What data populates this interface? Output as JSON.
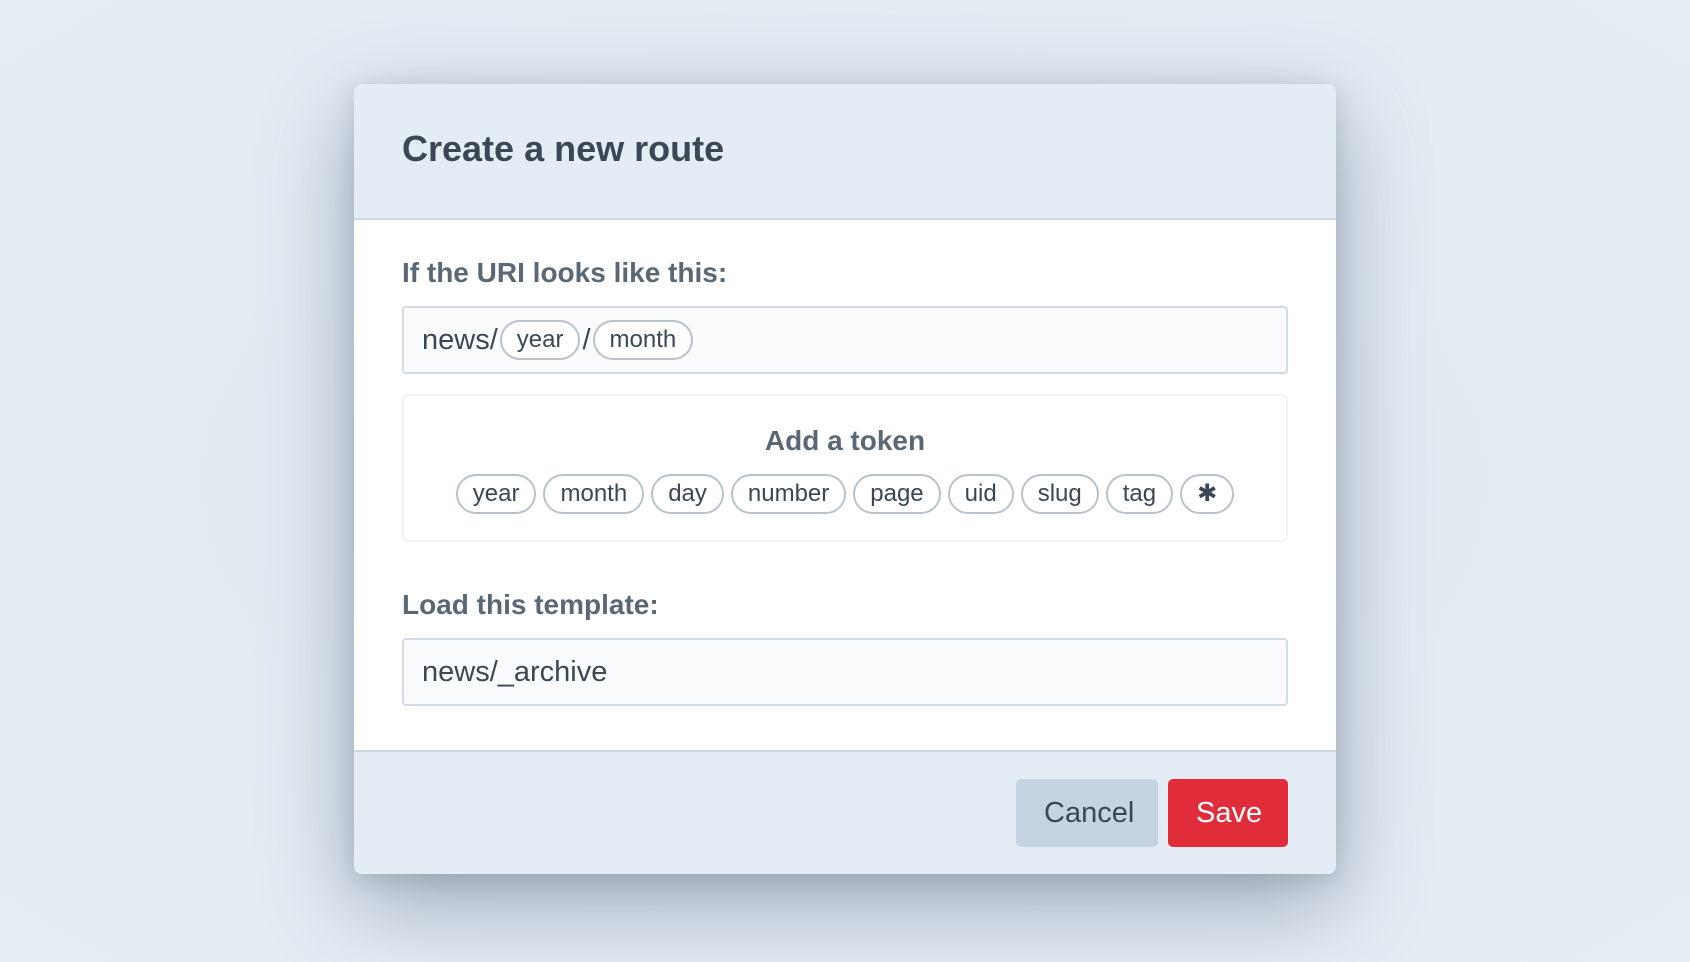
{
  "dialog": {
    "title": "Create a new route"
  },
  "uri_field": {
    "label": "If the URI looks like this:",
    "segments": {
      "prefix": "news/",
      "token1": "year",
      "separator": "/",
      "token2": "month"
    }
  },
  "token_panel": {
    "title": "Add a token",
    "tokens": [
      "year",
      "month",
      "day",
      "number",
      "page",
      "uid",
      "slug",
      "tag",
      "✱"
    ]
  },
  "template_field": {
    "label": "Load this template:",
    "value": "news/_archive"
  },
  "footer": {
    "cancel_label": "Cancel",
    "save_label": "Save"
  },
  "colors": {
    "save_button": "#e12d39",
    "cancel_button": "#c5d3e2",
    "header_background": "#e4ecf5"
  }
}
